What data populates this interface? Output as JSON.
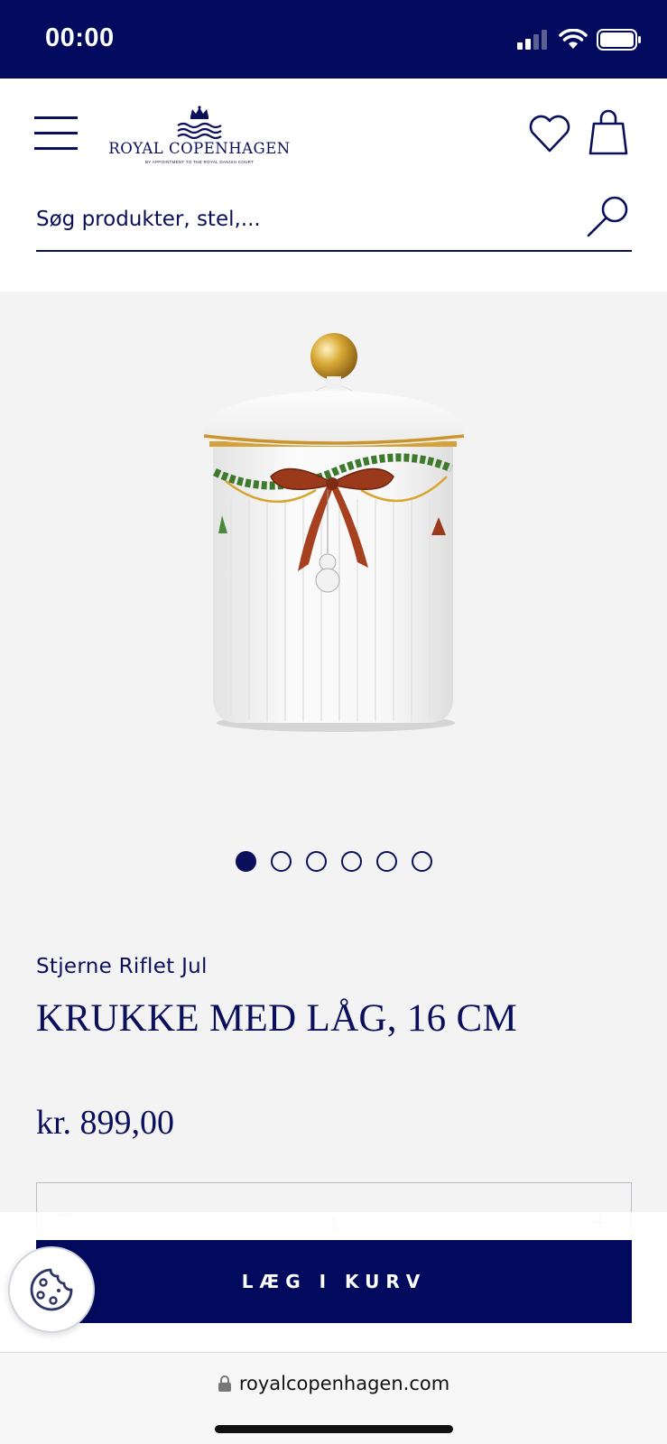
{
  "status_bar": {
    "time": "00:00"
  },
  "header": {
    "logo_text": "ROYAL COPENHAGEN",
    "logo_subtext": "BY APPOINTMENT TO THE ROYAL DANISH COURT",
    "search_placeholder": "Søg produkter, stel,..."
  },
  "gallery": {
    "total_images": 6,
    "active_index": 0
  },
  "product": {
    "collection": "Stjerne Riflet Jul",
    "title": "KRUKKE MED LÅG, 16 CM",
    "price": "kr. 899,00",
    "quantity": "1"
  },
  "actions": {
    "add_to_cart": "LÆG I KURV"
  },
  "browser": {
    "url": "royalcopenhagen.com"
  },
  "colors": {
    "brand_navy": "#020a5e",
    "text_navy": "#0a0f5c",
    "background": "#f3f3f3"
  }
}
